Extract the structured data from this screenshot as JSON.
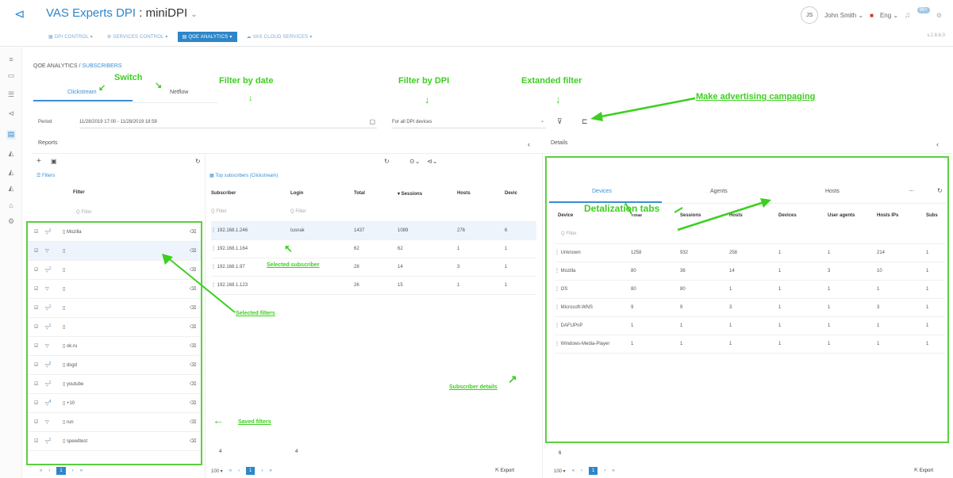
{
  "header": {
    "title_brand": "VAS Experts DPI",
    "title_sep": " : ",
    "title_app": "miniDPI",
    "title_caret": "⌄",
    "user_initials": "JS",
    "user_name": "John Smith ⌄",
    "lang": "Eng ⌄",
    "notif_count": "99+",
    "version": "v.2.8.6.0"
  },
  "nav": {
    "items": [
      "DPI CONTROL ▾",
      "SERVICES CONTROL ▾",
      "QOE ANALYTICS ▾",
      "VAS CLOUD SERVICES ▾"
    ]
  },
  "breadcrumb": {
    "section": "QOE ANALYTICS / ",
    "page": "SUBSCRIBERS"
  },
  "tabs": {
    "clickstream": "Clickstream",
    "netflow": "Netflow"
  },
  "period": {
    "label": "Period",
    "value": "11/28/2019 17:00 - 11/28/2019 18:59",
    "dpi": "For all DPI devices"
  },
  "reports": {
    "title": "Reports"
  },
  "details": {
    "title": "Details"
  },
  "filters": {
    "title": "Filters",
    "column": "Filter",
    "placeholder": "Q Filter",
    "rows": [
      {
        "name": "Mozilla",
        "num": "1"
      },
      {
        "name": "",
        "num": ""
      },
      {
        "name": "",
        "num": "1"
      },
      {
        "name": "",
        "num": ""
      },
      {
        "name": "",
        "num": "1"
      },
      {
        "name": "",
        "num": "1"
      },
      {
        "name": "ok.ru",
        "num": ""
      },
      {
        "name": "dsgd",
        "num": "2"
      },
      {
        "name": "youtube",
        "num": "1"
      },
      {
        "name": "+10",
        "num": "4"
      },
      {
        "name": "run",
        "num": ""
      },
      {
        "name": "speedtest",
        "num": "1"
      }
    ]
  },
  "subscribers": {
    "title": "Top subscribers (Clickstream)",
    "columns": [
      "Subscriber",
      "Login",
      "Total",
      "▾ Sessions",
      "Hosts",
      "Devic"
    ],
    "placeholder": "Q Filter",
    "rows": [
      [
        "192.168.1.246",
        "tusnak",
        "1437",
        "1089",
        "276",
        "6"
      ],
      [
        "192.168.1.164",
        "",
        "62",
        "62",
        "1",
        "1"
      ],
      [
        "192.168.1.97",
        "",
        "28",
        "14",
        "3",
        "1"
      ],
      [
        "192.168.1.123",
        "",
        "26",
        "15",
        "1",
        "1"
      ]
    ],
    "count_left": "4",
    "count_right": "4"
  },
  "detail_tabs": {
    "devices": "Devices",
    "agents": "Agents",
    "hosts": "Hosts",
    "more": "⋯"
  },
  "devices": {
    "columns": [
      "Device",
      "Total",
      "Sessions",
      "Hosts",
      "Devices",
      "User agents",
      "Hosts IPs",
      "Subs"
    ],
    "placeholder": "Q Filter",
    "rows": [
      [
        "Unknown",
        "1258",
        "932",
        "258",
        "1",
        "1",
        "214",
        "1"
      ],
      [
        "Mozilla",
        "80",
        "36",
        "14",
        "1",
        "3",
        "10",
        "1"
      ],
      [
        "OS",
        "80",
        "80",
        "1",
        "1",
        "1",
        "1",
        "1"
      ],
      [
        "Microsoft-WNS",
        "9",
        "9",
        "3",
        "1",
        "1",
        "3",
        "1"
      ],
      [
        "DAFUPnP",
        "1",
        "1",
        "1",
        "1",
        "1",
        "1",
        "1"
      ],
      [
        "Windows-Media-Player",
        "1",
        "1",
        "1",
        "1",
        "1",
        "1",
        "1"
      ]
    ],
    "count": "6"
  },
  "pager": {
    "page_size": "100 ▾",
    "first": "«",
    "prev": "‹",
    "current": "1",
    "next": "›",
    "last": "»",
    "export": "Export"
  },
  "annotations": {
    "switch": "Switch",
    "filter_by_date": "Filter by date",
    "filter_by_dpi": "Filter by DPI",
    "extended_filter": "Extanded filter",
    "make_ad": "Make advertising campaging",
    "detalization_tabs": "Detalization tabs",
    "selected_subscriber": "Selected subscriber",
    "selected_filters": "Selected filters",
    "subscriber_details": "Subscriber details",
    "saved_filters": "Saved filters"
  },
  "colors": {
    "accent": "#2e86c9",
    "annotation": "#3ccf1f",
    "box": "#5ccf3f"
  }
}
